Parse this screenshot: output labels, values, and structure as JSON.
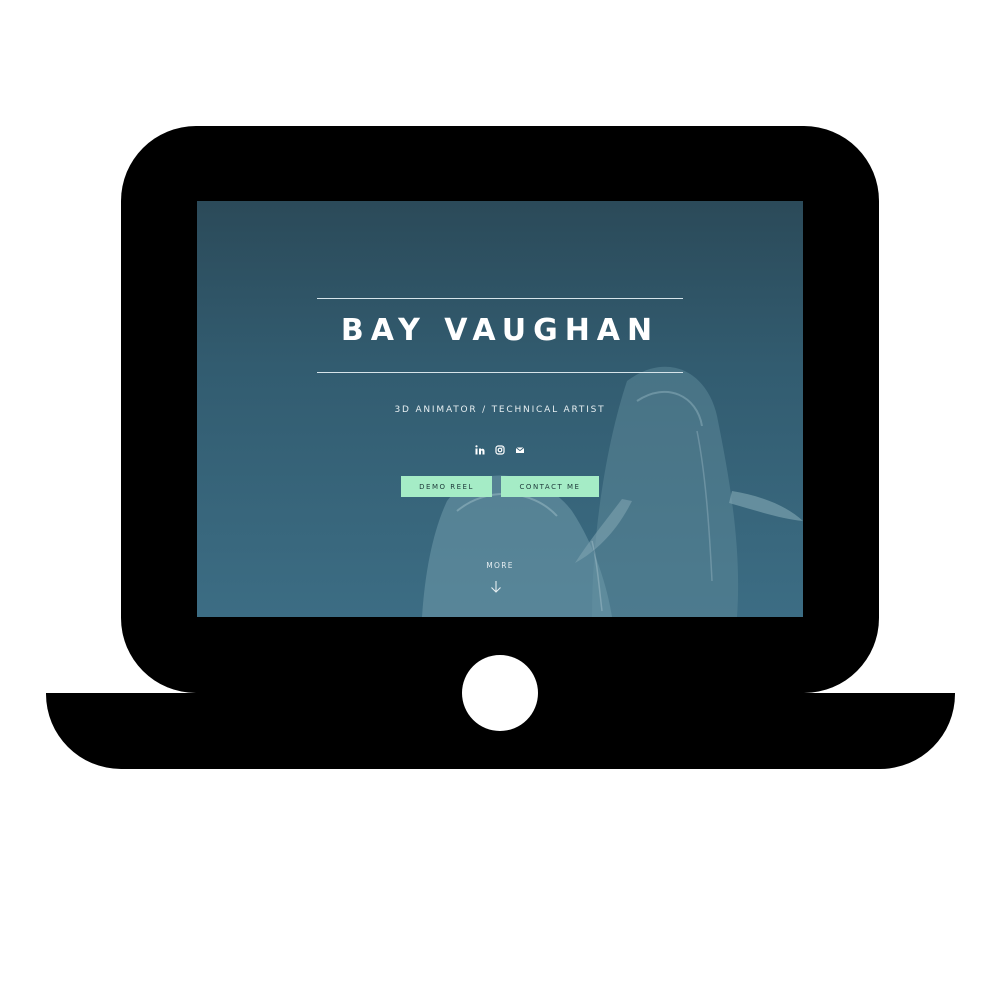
{
  "hero": {
    "name": "BAY VAUGHAN",
    "tagline": "3D ANIMATOR / TECHNICAL ARTIST"
  },
  "socials": [
    {
      "name": "linkedin-icon"
    },
    {
      "name": "instagram-icon"
    },
    {
      "name": "email-icon"
    }
  ],
  "buttons": {
    "demo_reel": "DEMO REEL",
    "contact_me": "CONTACT ME"
  },
  "more": {
    "label": "MORE",
    "icon": "arrow-down-icon"
  },
  "colors": {
    "background_top": "#2b4a59",
    "background_bottom": "#3c6d84",
    "button_accent": "#a5ecc6",
    "laptop": "#000000"
  }
}
